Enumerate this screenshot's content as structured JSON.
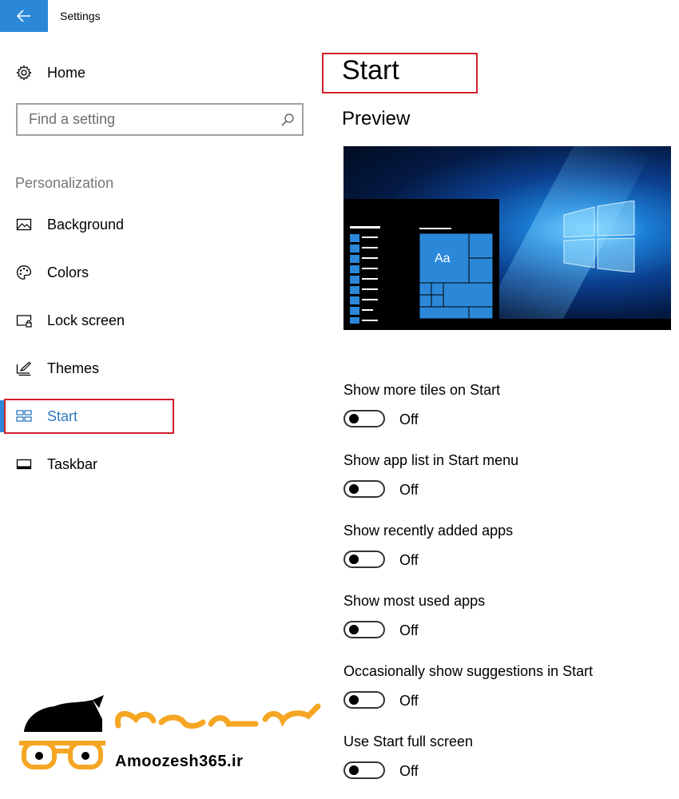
{
  "window": {
    "title": "Settings"
  },
  "sidebar": {
    "home_label": "Home",
    "search": {
      "placeholder": "Find a setting",
      "value": ""
    },
    "section_title": "Personalization",
    "items": [
      {
        "label": "Background",
        "icon": "image-icon"
      },
      {
        "label": "Colors",
        "icon": "palette-icon"
      },
      {
        "label": "Lock screen",
        "icon": "lock-screen-icon"
      },
      {
        "label": "Themes",
        "icon": "themes-icon"
      },
      {
        "label": "Start",
        "icon": "start-tiles-icon",
        "active": true
      },
      {
        "label": "Taskbar",
        "icon": "taskbar-icon"
      }
    ]
  },
  "main": {
    "title": "Start",
    "preview_heading": "Preview",
    "preview": {
      "tile_text": "Aa"
    },
    "settings": [
      {
        "label": "Show more tiles on Start",
        "state": "Off"
      },
      {
        "label": "Show app list in Start menu",
        "state": "Off"
      },
      {
        "label": "Show recently added apps",
        "state": "Off"
      },
      {
        "label": "Show most used apps",
        "state": "Off"
      },
      {
        "label": "Occasionally show suggestions in Start",
        "state": "Off"
      },
      {
        "label": "Use Start full screen",
        "state": "Off"
      }
    ]
  },
  "watermark": {
    "url": "Amoozesh365.ir"
  },
  "colors": {
    "accent": "#2b88d8",
    "highlight_box": "#d3202b",
    "logo_orange": "#f5a623"
  }
}
